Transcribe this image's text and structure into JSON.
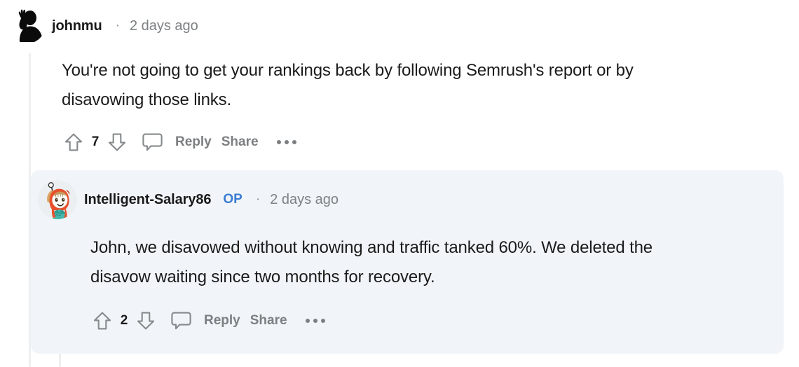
{
  "thread": {
    "highlight_color": "#f1f5f9",
    "thread_line_color": "#edeff1",
    "op_badge_color": "#3a7cd2"
  },
  "comments": [
    {
      "id": "comment-johnmu",
      "username": "johnmu",
      "is_op": false,
      "op_label": "",
      "separator": "·",
      "timestamp": "2 days ago",
      "body": "You're not going to get your rankings back by following Semrush's report or by disavowing those links.",
      "avatar_name": "avatar-johnmu-silhouette",
      "actions": {
        "upvote_icon": "upvote-arrow-icon",
        "vote_count": "7",
        "downvote_icon": "downvote-arrow-icon",
        "comment_icon": "comment-bubble-icon",
        "reply_label": "Reply",
        "share_label": "Share",
        "more_icon": "more-options-icon"
      }
    },
    {
      "id": "comment-intelligent-salary86",
      "username": "Intelligent-Salary86",
      "is_op": true,
      "op_label": "OP",
      "separator": "·",
      "timestamp": "2 days ago",
      "body": "John, we disavowed without knowing and traffic tanked 60%. We deleted the disavow waiting since two months for recovery.",
      "avatar_name": "avatar-snoo-orange-hood",
      "actions": {
        "upvote_icon": "upvote-arrow-icon",
        "vote_count": "2",
        "downvote_icon": "downvote-arrow-icon",
        "comment_icon": "comment-bubble-icon",
        "reply_label": "Reply",
        "share_label": "Share",
        "more_icon": "more-options-icon"
      }
    }
  ]
}
